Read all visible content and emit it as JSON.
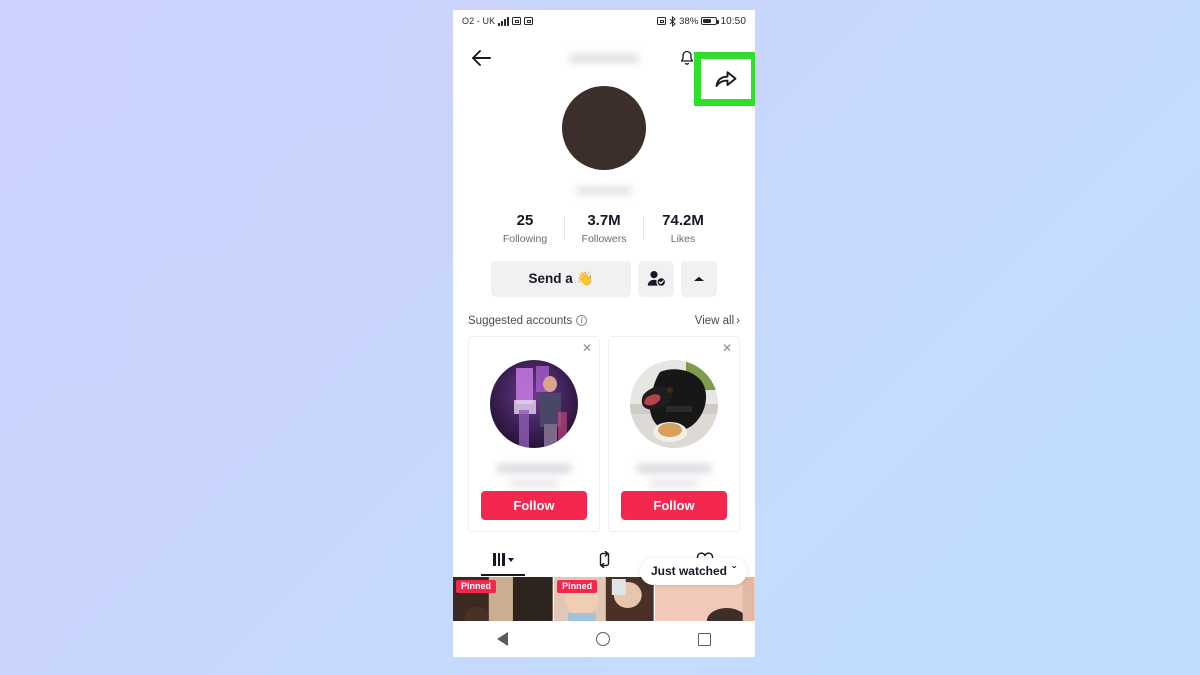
{
  "status_bar": {
    "carrier": "O2 - UK",
    "signal_icon": "signal-bars-icon",
    "vibrate_icon": "vibrate-icon",
    "dual_sim_icon": "dual-sim-icon",
    "nfc_icon": "nfc-icon",
    "bluetooth_icon": "bluetooth-icon",
    "battery_percent": "38%",
    "battery_icon": "battery-icon",
    "time": "10:50"
  },
  "header": {
    "back_icon": "back-arrow-icon",
    "title_blurred": "••••••••••••••",
    "bell_icon": "bell-icon",
    "share_icon": "share-arrow-icon",
    "highlight_color": "#2ee02a"
  },
  "profile": {
    "avatar_name": "profile-avatar",
    "avatar_color": "#3c2e2b",
    "handle_blurred": "••••••••••••",
    "stats": [
      {
        "value": "25",
        "label": "Following"
      },
      {
        "value": "3.7M",
        "label": "Followers"
      },
      {
        "value": "74.2M",
        "label": "Likes"
      }
    ],
    "actions": {
      "send_label": "Send a",
      "send_emoji": "👋",
      "add_friend_icon": "person-check-icon",
      "expand_icon": "caret-up-icon"
    }
  },
  "suggested": {
    "title": "Suggested accounts",
    "info_icon": "info-circle-icon",
    "info_glyph": "i",
    "view_all": "View all",
    "view_all_chevron": "›",
    "close_glyph": "✕",
    "cards": [
      {
        "name": "suggested-card-concert",
        "avatar": "concert-photo-avatar",
        "follow_label": "Follow"
      },
      {
        "name": "suggested-card-dog",
        "avatar": "black-dog-photo-avatar",
        "follow_label": "Follow"
      }
    ],
    "follow_color": "#f4274f"
  },
  "tabs": {
    "items": [
      {
        "name": "tab-posts",
        "icon": "grid-posts-icon",
        "caret": "caret-down-icon",
        "active": true
      },
      {
        "name": "tab-reposts",
        "icon": "repost-icon",
        "active": false
      },
      {
        "name": "tab-liked",
        "icon": "heart-icon",
        "active": false
      }
    ],
    "just_watched_label": "Just watched",
    "just_watched_chevron": "ˇ"
  },
  "videos": [
    {
      "name": "video-thumb-1",
      "badge": "Pinned"
    },
    {
      "name": "video-thumb-2",
      "badge": "Pinned"
    },
    {
      "name": "video-thumb-3",
      "badge": ""
    }
  ],
  "navbar": {
    "back_icon": "android-back-icon",
    "home_icon": "android-home-icon",
    "recents_icon": "android-recents-icon"
  }
}
